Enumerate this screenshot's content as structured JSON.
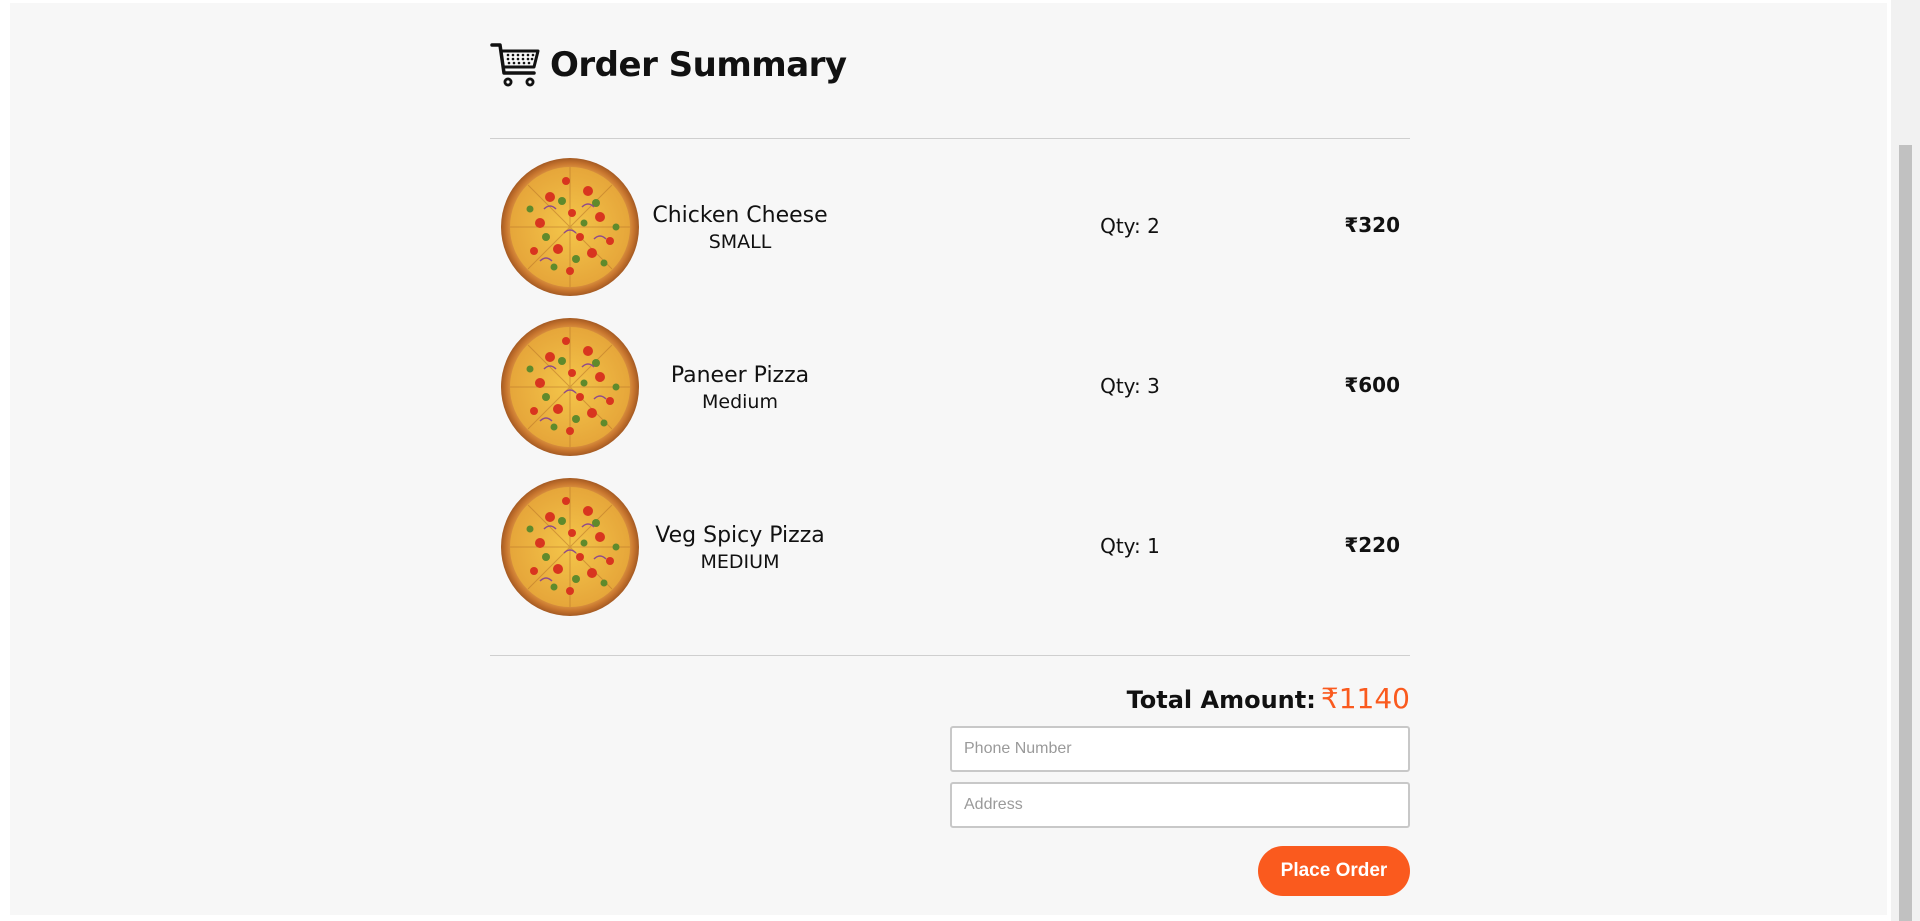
{
  "page": {
    "title": "Order Summary"
  },
  "cart": {
    "items": [
      {
        "name": "Chicken Cheese",
        "size": "SMALL",
        "qty": "Qty: 2",
        "price": "₹320"
      },
      {
        "name": "Paneer Pizza",
        "size": "Medium",
        "qty": "Qty: 3",
        "price": "₹600"
      },
      {
        "name": "Veg Spicy Pizza",
        "size": "MEDIUM",
        "qty": "Qty: 1",
        "price": "₹220"
      }
    ],
    "total_label": "Total Amount:",
    "total_value": "₹1140"
  },
  "form": {
    "phone_placeholder": "Phone Number",
    "address_placeholder": "Address",
    "submit_label": "Place Order"
  },
  "colors": {
    "accent": "#fa5a1e",
    "background": "#f7f7f7"
  },
  "icons": {
    "header": "shopping-cart-icon"
  }
}
